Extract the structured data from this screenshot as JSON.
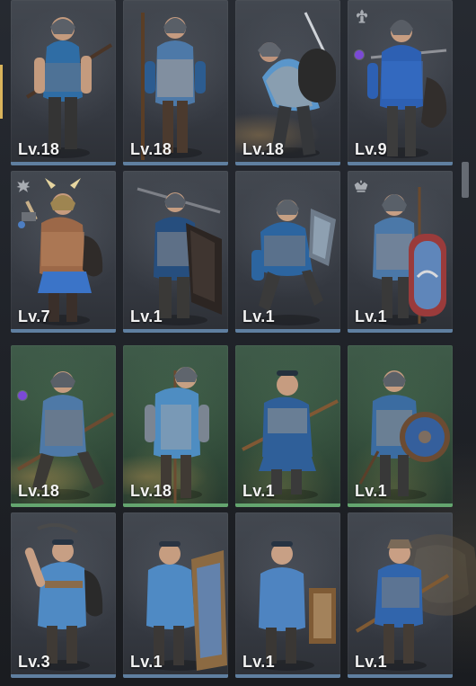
{
  "theme": {
    "accent": "#d9b45b",
    "gray_card": "#3a3e45",
    "green_card": "#35513e",
    "gray_bar": "#5f7fa0",
    "green_bar": "#64a56f",
    "purple_marker": "#7b49d6"
  },
  "units": [
    {
      "level_text": "Lv.18",
      "card_style": "gray",
      "figure_icon": "infantry-halberdier-icon",
      "badge": ""
    },
    {
      "level_text": "Lv.18",
      "card_style": "gray",
      "figure_icon": "pike-soldier-icon",
      "badge": ""
    },
    {
      "level_text": "Lv.18",
      "card_style": "gray",
      "figure_icon": "lunging-swordsman-icon",
      "badge": ""
    },
    {
      "level_text": "Lv.9",
      "card_style": "gray",
      "figure_icon": "blue-knight-icon",
      "badge": "fleur-de-lis-emblem-icon"
    },
    {
      "level_text": "Lv.7",
      "card_style": "gray",
      "figure_icon": "winged-warrior-icon",
      "badge": "eagle-emblem-icon"
    },
    {
      "level_text": "Lv.1",
      "card_style": "gray",
      "figure_icon": "tower-shield-soldier-icon",
      "badge": ""
    },
    {
      "level_text": "Lv.1",
      "card_style": "gray",
      "figure_icon": "crouching-shieldman-icon",
      "badge": ""
    },
    {
      "level_text": "Lv.1",
      "card_style": "gray",
      "figure_icon": "painted-shield-guard-icon",
      "badge": "crowned-emblem-icon"
    },
    {
      "level_text": "Lv.18",
      "card_style": "green",
      "figure_icon": "spear-infantry-icon",
      "badge": "purple-marker-icon"
    },
    {
      "level_text": "Lv.18",
      "card_style": "green",
      "figure_icon": "standing-spearman-icon",
      "badge": ""
    },
    {
      "level_text": "Lv.1",
      "card_style": "green",
      "figure_icon": "charging-spearman-icon",
      "badge": ""
    },
    {
      "level_text": "Lv.1",
      "card_style": "green",
      "figure_icon": "round-shield-guard-icon",
      "badge": ""
    },
    {
      "level_text": "Lv.3",
      "card_style": "gray",
      "figure_icon": "swordsman-icon",
      "badge": ""
    },
    {
      "level_text": "Lv.1",
      "card_style": "gray",
      "figure_icon": "shield-bearer-icon",
      "badge": ""
    },
    {
      "level_text": "Lv.1",
      "card_style": "gray",
      "figure_icon": "wall-shield-fighter-icon",
      "badge": ""
    },
    {
      "level_text": "Lv.1",
      "card_style": "gray",
      "figure_icon": "polearm-recruit-icon",
      "badge": ""
    }
  ]
}
